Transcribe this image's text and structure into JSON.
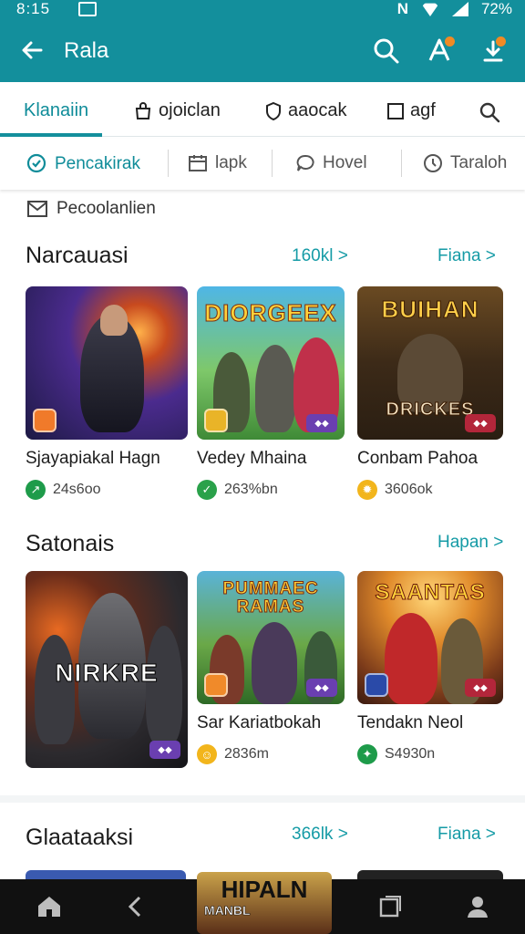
{
  "status": {
    "time": "8:15",
    "battery": "72%"
  },
  "appbar": {
    "title": "Rala",
    "back_icon": "back-arrow-icon",
    "icons": [
      "search-icon",
      "notification-icon",
      "download-icon"
    ],
    "accent": "#138f9c"
  },
  "tabs": [
    {
      "label": "Klanaiin",
      "active": true
    },
    {
      "label": "ojoiclan",
      "icon": "bag-icon"
    },
    {
      "label": "aaocak",
      "icon": "shield-icon"
    },
    {
      "label": "agf",
      "icon": "square-icon"
    },
    {
      "label": "",
      "icon": "search-icon"
    }
  ],
  "chips": [
    {
      "label": "Pencakirak",
      "icon": "chat-bubble-icon",
      "active": true
    },
    {
      "label": "lapk",
      "icon": "calendar-icon"
    },
    {
      "label": "Hovel",
      "icon": "speech-icon"
    },
    {
      "label": "Taraloh",
      "icon": "clock-icon"
    }
  ],
  "notice": {
    "label": "Pecoolanlien",
    "icon": "mail-icon"
  },
  "sections": [
    {
      "title": "Narcauasi",
      "link_a": "160kl >",
      "link_b": "Fiana >",
      "items": [
        {
          "name": "Sjayapiakal Hagn",
          "meta": "24s6oo",
          "meta_color": "#1e9b4a"
        },
        {
          "name": "Vedey Mhaina",
          "meta": "263%bn",
          "meta_color": "#2aa14a",
          "art_text": "DIORGEEX"
        },
        {
          "name": "Conbam Pahoa",
          "meta": "3606ok",
          "meta_color": "#f2b51c",
          "art_text": "BUIHAN",
          "art_text2": "DRICKES"
        }
      ]
    },
    {
      "title": "Satonais",
      "link_b": "Hapan >",
      "items": [
        {
          "name": "",
          "meta": "",
          "art_text": "NIRKRE"
        },
        {
          "name": "Sar Kariatbokah",
          "meta": "2836m",
          "meta_color": "#f2b51c",
          "art_text": "PUMMAEC RAMAS"
        },
        {
          "name": "Tendakn Neol",
          "meta": "S4930n",
          "meta_color": "#1e9b4a",
          "art_text": "SAANTAS"
        }
      ]
    },
    {
      "title": "Glaataaksi",
      "link_a": "366lk >",
      "link_b": "Fiana >"
    }
  ],
  "navbar": {
    "items": [
      "home-icon",
      "back-icon",
      "recent-apps-icon",
      "profile-icon"
    ],
    "overlay_text": "HIPALN",
    "overlay_subtext": "MANBL"
  }
}
